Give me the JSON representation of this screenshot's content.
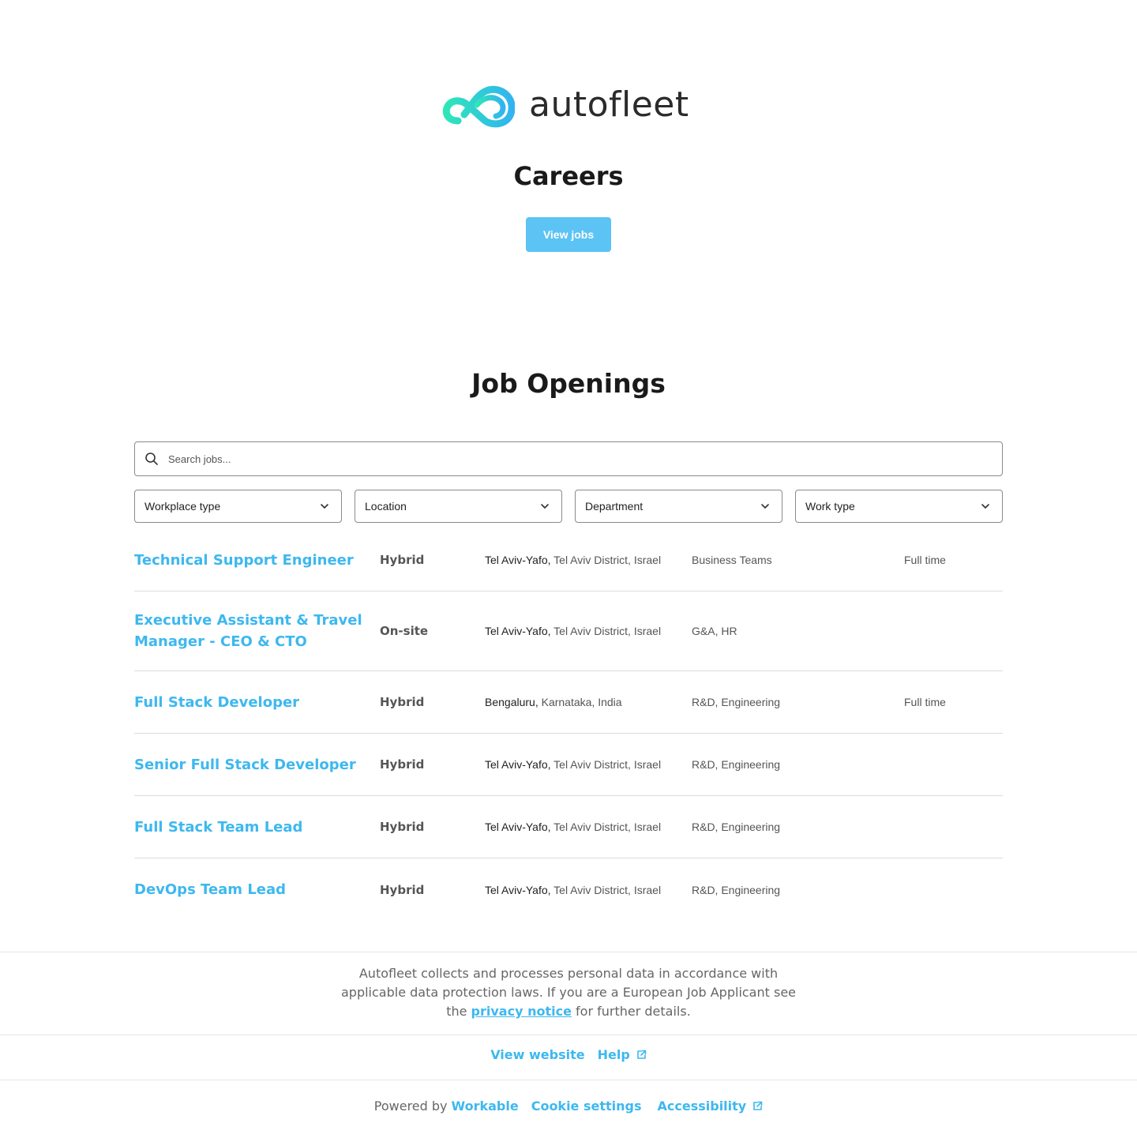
{
  "brand": {
    "name": "autofleet",
    "accent": "#3db8ef",
    "logo_gradient": [
      "#2ee6b8",
      "#32b4f0"
    ]
  },
  "header": {
    "title": "Careers",
    "view_jobs_label": "View jobs"
  },
  "openings": {
    "title": "Job Openings",
    "search_placeholder": "Search jobs...",
    "filters": [
      "Workplace type",
      "Location",
      "Department",
      "Work type"
    ],
    "jobs": [
      {
        "title": "Technical Support Engineer",
        "workplace": "Hybrid",
        "city": "Tel Aviv-Yafo,",
        "region": " Tel Aviv District, Israel",
        "department": "Business Teams",
        "work_type": "Full time"
      },
      {
        "title": "Executive Assistant & Travel Manager - CEO & CTO",
        "workplace": "On-site",
        "city": "Tel Aviv-Yafo,",
        "region": " Tel Aviv District, Israel",
        "department": "G&A, HR",
        "work_type": ""
      },
      {
        "title": "Full Stack Developer",
        "workplace": "Hybrid",
        "city": "Bengaluru,",
        "region": " Karnataka, India",
        "department": "R&D, Engineering",
        "work_type": "Full time"
      },
      {
        "title": "Senior Full Stack Developer",
        "workplace": "Hybrid",
        "city": "Tel Aviv-Yafo,",
        "region": " Tel Aviv District, Israel",
        "department": "R&D, Engineering",
        "work_type": ""
      },
      {
        "title": "Full Stack Team Lead",
        "workplace": "Hybrid",
        "city": "Tel Aviv-Yafo,",
        "region": " Tel Aviv District, Israel",
        "department": "R&D, Engineering",
        "work_type": ""
      },
      {
        "title": "DevOps Team Lead",
        "workplace": "Hybrid",
        "city": "Tel Aviv-Yafo,",
        "region": " Tel Aviv District, Israel",
        "department": "R&D, Engineering",
        "work_type": ""
      }
    ]
  },
  "footer": {
    "privacy_before": "Autofleet collects and processes personal data in accordance with applicable data protection laws. If you are a European Job Applicant see the ",
    "privacy_link": "privacy notice",
    "privacy_after": " for further details.",
    "view_website": "View website",
    "help": "Help",
    "powered_by": "Powered by",
    "workable": "Workable",
    "cookie_settings": "Cookie settings",
    "accessibility": "Accessibility"
  }
}
